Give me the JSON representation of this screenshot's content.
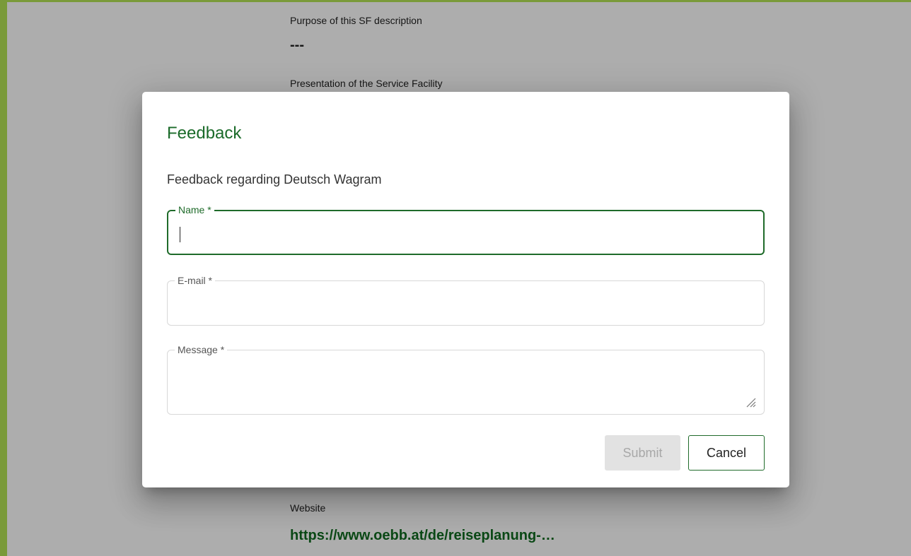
{
  "background": {
    "purpose_label": "Purpose of this SF description",
    "purpose_value": "---",
    "presentation_label": "Presentation of the Service Facility",
    "website_label": "Website",
    "website_link": "https://www.oebb.at/de/reiseplanung-…"
  },
  "dialog": {
    "title": "Feedback",
    "subtitle": "Feedback regarding Deutsch Wagram",
    "fields": {
      "name": {
        "label": "Name *",
        "value": ""
      },
      "email": {
        "label": "E-mail *",
        "value": ""
      },
      "message": {
        "label": "Message *",
        "value": ""
      }
    },
    "submit_label": "Submit",
    "cancel_label": "Cancel"
  },
  "colors": {
    "accent_green": "#1f6b2a",
    "frame_border": "#7a9a3a",
    "disabled_button": "#e2e2e2"
  }
}
